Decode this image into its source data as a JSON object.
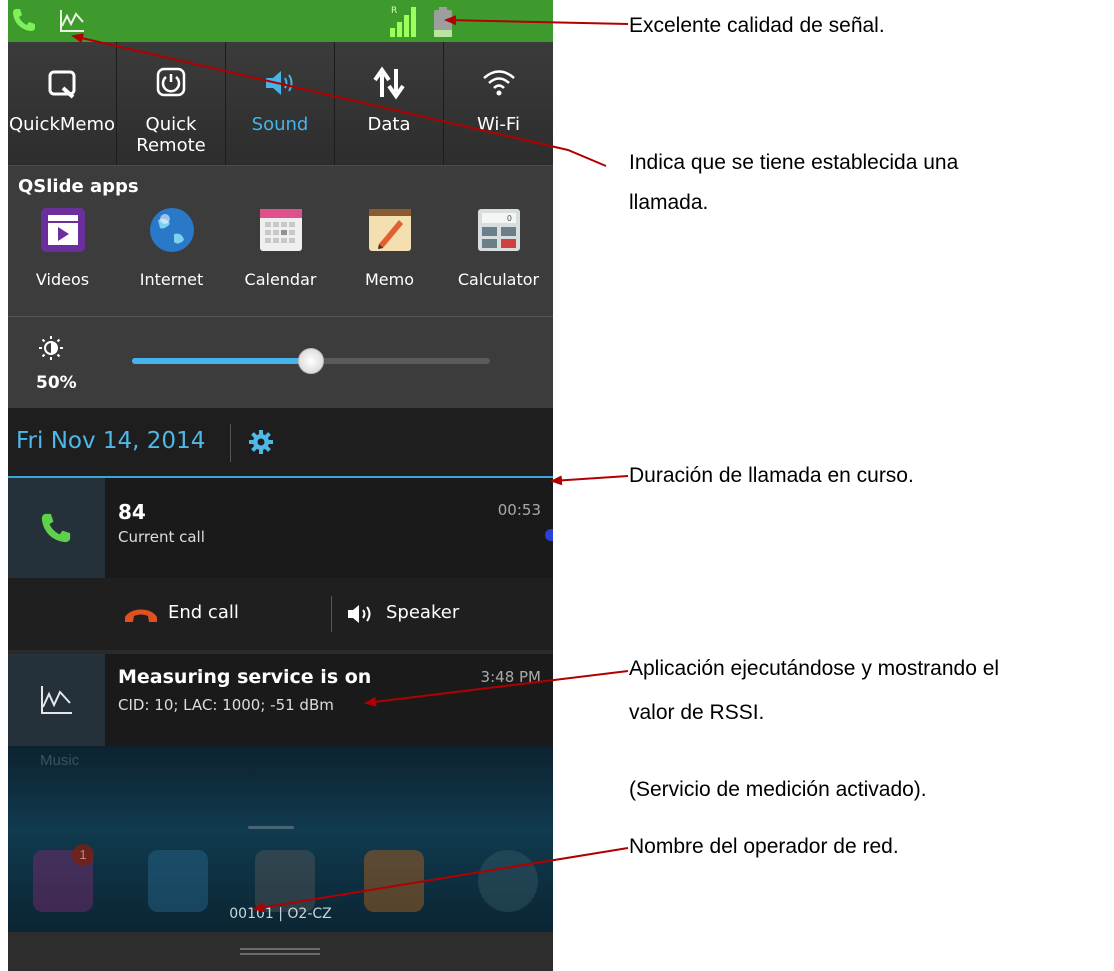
{
  "toggles": [
    {
      "label": "QuickMemo",
      "icon": "quickmemo-icon"
    },
    {
      "label": "Quick\nRemote",
      "icon": "quick-remote-icon"
    },
    {
      "label": "Sound",
      "icon": "sound-icon"
    },
    {
      "label": "Data",
      "icon": "data-icon"
    },
    {
      "label": "Wi-Fi",
      "icon": "wifi-icon"
    }
  ],
  "qslide": {
    "title": "QSlide apps",
    "apps": [
      {
        "label": "Videos",
        "icon": "videos-icon"
      },
      {
        "label": "Internet",
        "icon": "internet-icon"
      },
      {
        "label": "Calendar",
        "icon": "calendar-icon"
      },
      {
        "label": "Memo",
        "icon": "memo-icon"
      },
      {
        "label": "Calculator",
        "icon": "calculator-icon"
      }
    ]
  },
  "brightness": {
    "label": "50%",
    "level": 0.5
  },
  "date": "Fri Nov 14, 2014",
  "call_notification": {
    "number": "84",
    "status": "Current call",
    "duration": "00:53"
  },
  "call_actions": {
    "end_call": "End call",
    "speaker": "Speaker"
  },
  "measuring_notification": {
    "title": "Measuring service is on",
    "detail": "CID: 10; LAC: 1000; -51 dBm",
    "time": "3:48 PM"
  },
  "homescreen": {
    "music_label": "Music",
    "badge_count": "1",
    "operator": "00101 | O2-CZ"
  },
  "annotations": {
    "signal": "Excelente calidad de señal.",
    "call_line1": "Indica que se tiene establecida una",
    "call_line2": "llamada.",
    "duration": "Duración de llamada en curso.",
    "app_line1": "Aplicación ejecutándose y mostrando el",
    "app_line2": "valor de RSSI.",
    "service": "(Servicio de medición activado).",
    "operator": "Nombre del operador de red."
  },
  "colors": {
    "status_bar": "#3f9a2e",
    "accent": "#44b4ea",
    "arrow": "#b00000"
  }
}
